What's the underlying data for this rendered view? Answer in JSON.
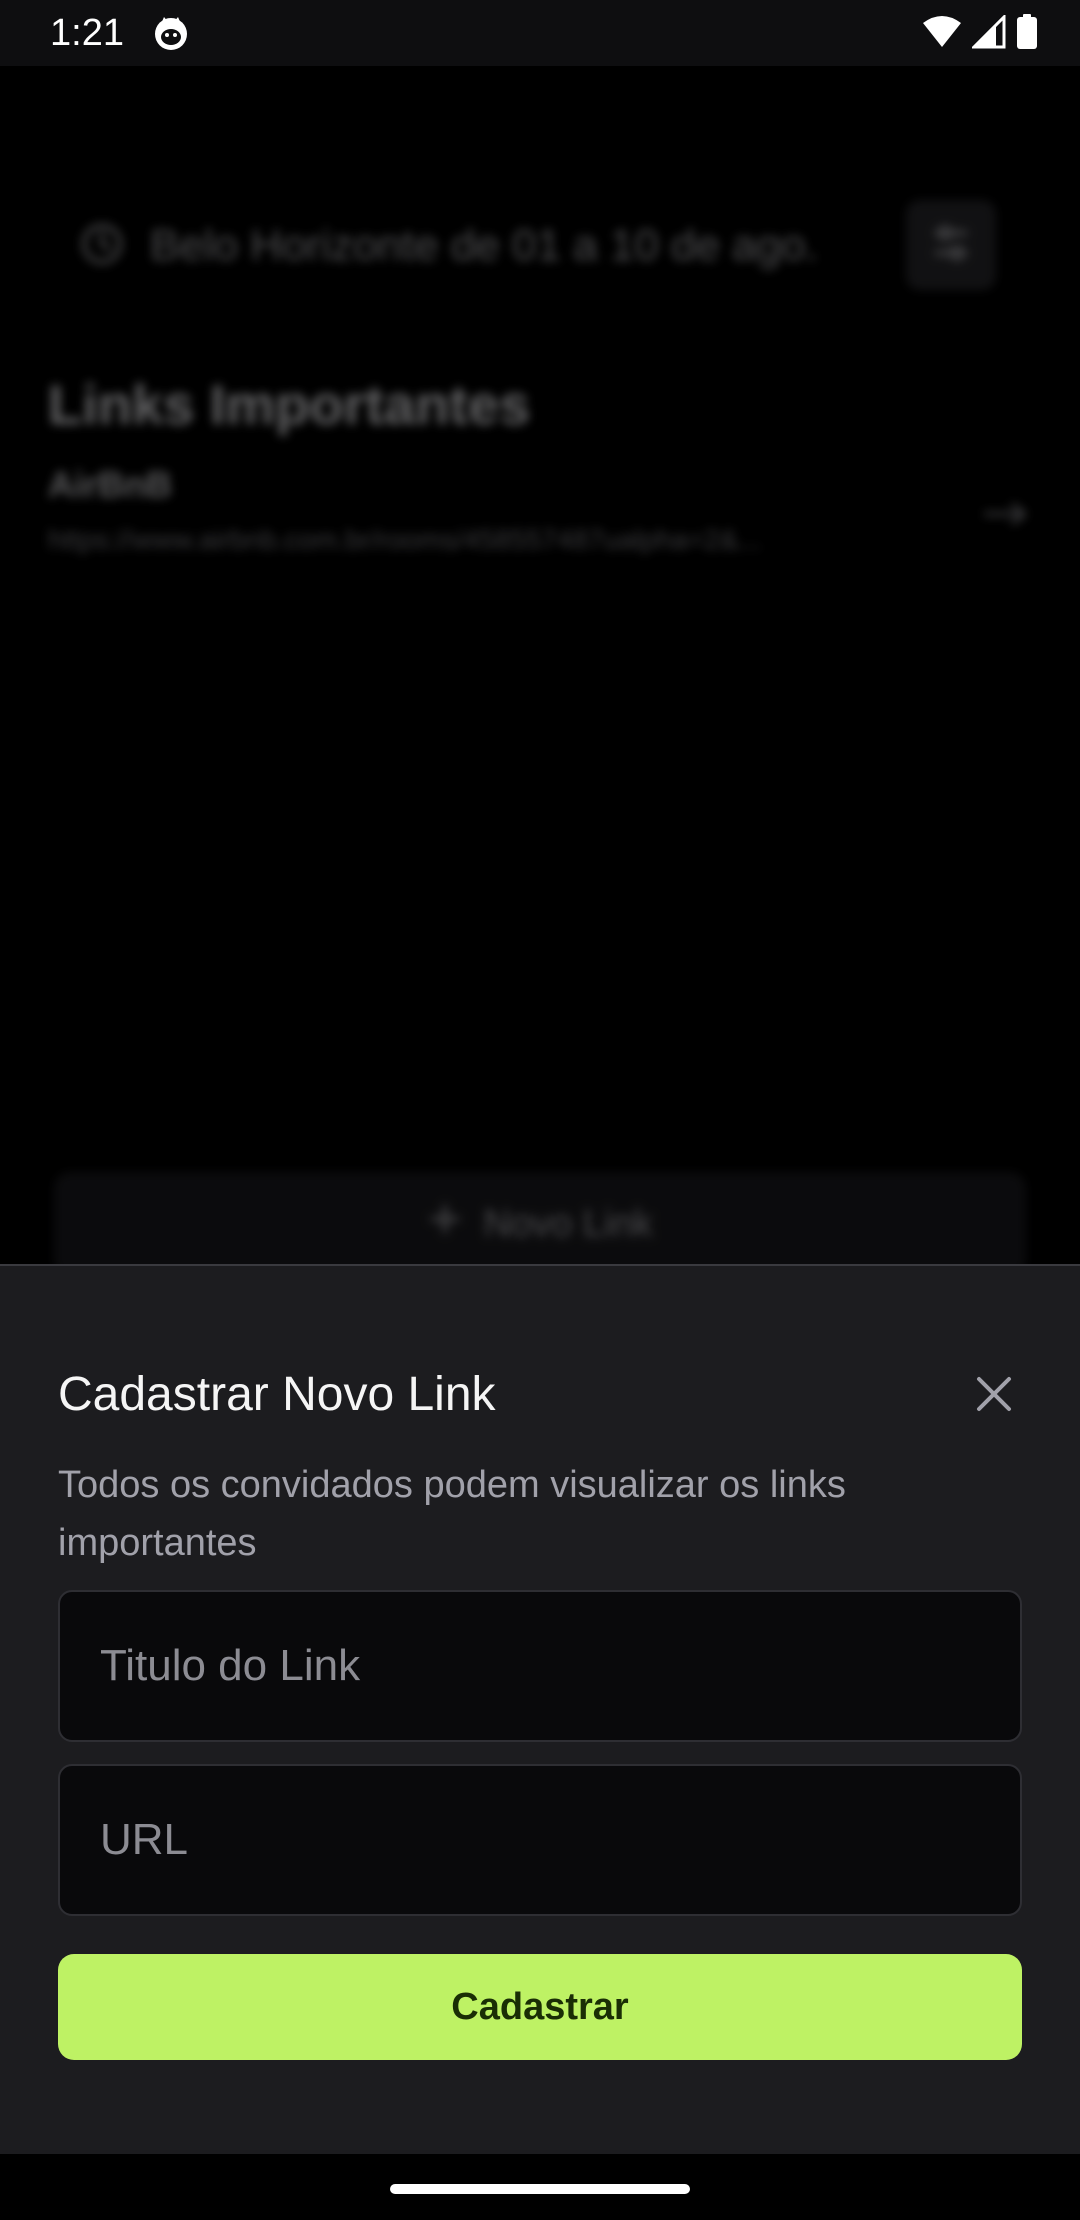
{
  "status_bar": {
    "time": "1:21",
    "app_icon": "cat-face-icon",
    "icons": [
      "wifi-icon",
      "cell-signal-icon",
      "battery-icon"
    ]
  },
  "background_page": {
    "trip_label": "Belo Horizonte de 01 a 10 de ago.",
    "section_title": "Links Importantes",
    "link_item": {
      "title": "AirBnB",
      "url": "https://www.airbnb.com.br/rooms/458557487ualpha=2&..."
    },
    "new_link_label": "Novo Link"
  },
  "sheet": {
    "title": "Cadastrar Novo Link",
    "description": "Todos os convidados podem visualizar os links importantes",
    "title_field": {
      "placeholder": "Titulo do Link",
      "value": ""
    },
    "url_field": {
      "placeholder": "URL",
      "value": ""
    },
    "submit_label": "Cadastrar"
  },
  "colors": {
    "accent": "#bef264",
    "sheet_background": "#1c1c1f",
    "field_background": "#09090b",
    "muted_text": "#a1a1aa"
  }
}
